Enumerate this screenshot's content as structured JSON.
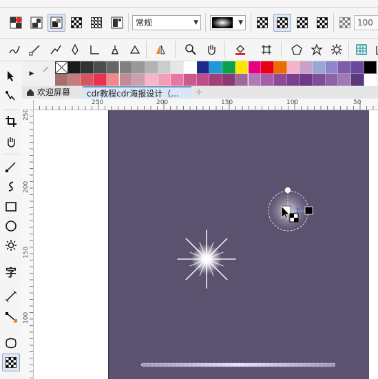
{
  "property_bar": {
    "style_select": "常规",
    "opacity_value": "100"
  },
  "tabs": [
    {
      "label": "欢迎屏幕"
    },
    {
      "label": "cdr教程cdr海报设计（..."
    },
    {
      "label": "+"
    }
  ],
  "rulers": {
    "horizontal": [
      "250",
      "200",
      "150",
      "100",
      "50"
    ],
    "vertical": [
      "250",
      "200",
      "150",
      "100"
    ]
  },
  "palette": {
    "row1": [
      "#ffffff",
      "#1a1a1a",
      "#333333",
      "#4d4d4d",
      "#666666",
      "#808080",
      "#999999",
      "#b3b3b3",
      "#cccccc",
      "#e6e6e6",
      "#ffffff",
      "#1f2a8c",
      "#1e9ad6",
      "#0aa14a",
      "#ffe600",
      "#e4007f",
      "#e60012",
      "#ec6c00",
      "#f5b5c8",
      "#c8a0c8",
      "#9aa6d6",
      "#8d86c9",
      "#7b5ea7",
      "#6a4a9c",
      "#000000"
    ],
    "row2": [
      "#a56f6f",
      "#c47c7c",
      "#d4545f",
      "#e8324d",
      "#f08a8a",
      "#c58a97",
      "#c9a0ad",
      "#f5b7c8",
      "#f29fb4",
      "#e877a3",
      "#c85a8f",
      "#c04a8a",
      "#a0407a",
      "#8a3a72",
      "#9c6a9a",
      "#b07ab8",
      "#a45fa8",
      "#8e4a9a",
      "#7a3f8e",
      "#6e3a88",
      "#7c4f96",
      "#8e64a8",
      "#a07ab6",
      "#5a3a7a",
      "#ffffff"
    ]
  },
  "colors": {
    "canvas_rect": "#5b526f",
    "accent": "#dde7f3"
  }
}
